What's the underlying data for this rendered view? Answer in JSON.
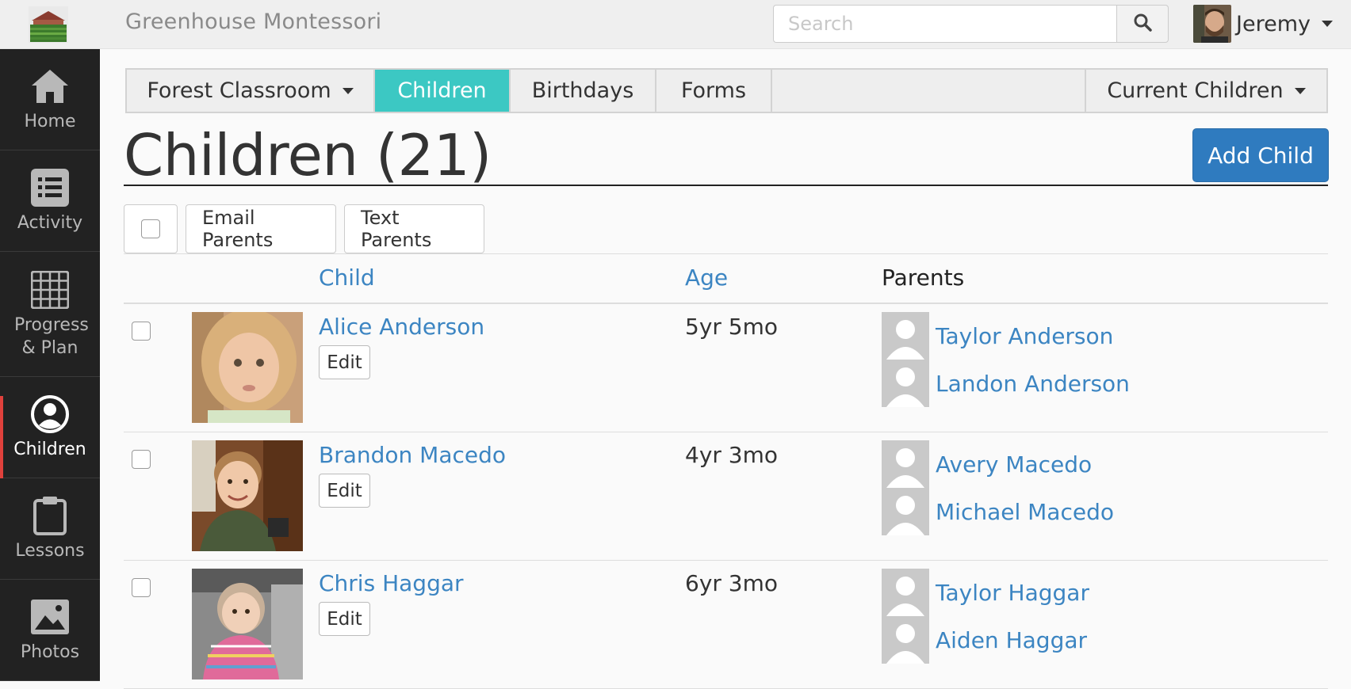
{
  "header": {
    "school_name": "Greenhouse Montessori",
    "search_placeholder": "Search",
    "user_name": "Jeremy"
  },
  "sidebar": {
    "items": [
      {
        "label": "Home",
        "icon": "home-icon"
      },
      {
        "label": "Activity",
        "icon": "list-icon"
      },
      {
        "label": "Progress & Plan",
        "icon": "grid-icon"
      },
      {
        "label": "Children",
        "icon": "person-circle-icon",
        "active": true
      },
      {
        "label": "Lessons",
        "icon": "clipboard-icon"
      },
      {
        "label": "Photos",
        "icon": "photo-icon"
      }
    ]
  },
  "tabs": {
    "classroom": "Forest Classroom",
    "children": "Children",
    "birthdays": "Birthdays",
    "forms": "Forms",
    "filter": "Current Children"
  },
  "page": {
    "title": "Children (21)",
    "add_child": "Add Child"
  },
  "bulk": {
    "email_parents": "Email Parents",
    "text_parents": "Text Parents"
  },
  "table": {
    "headers": {
      "child": "Child",
      "age": "Age",
      "parents": "Parents"
    },
    "edit_label": "Edit",
    "rows": [
      {
        "name": "Alice Anderson",
        "age": "5yr 5mo",
        "parents": [
          "Taylor Anderson",
          "Landon Anderson"
        ]
      },
      {
        "name": "Brandon Macedo",
        "age": "4yr 3mo",
        "parents": [
          "Avery Macedo",
          "Michael Macedo"
        ]
      },
      {
        "name": "Chris Haggar",
        "age": "6yr 3mo",
        "parents": [
          "Taylor Haggar",
          "Aiden Haggar"
        ]
      }
    ]
  },
  "colors": {
    "accent_tab": "#3cc8c3",
    "primary_button": "#2f7bbf",
    "link": "#3c85c2",
    "sidebar_bg": "#222222",
    "active_marker": "#e0413c"
  }
}
